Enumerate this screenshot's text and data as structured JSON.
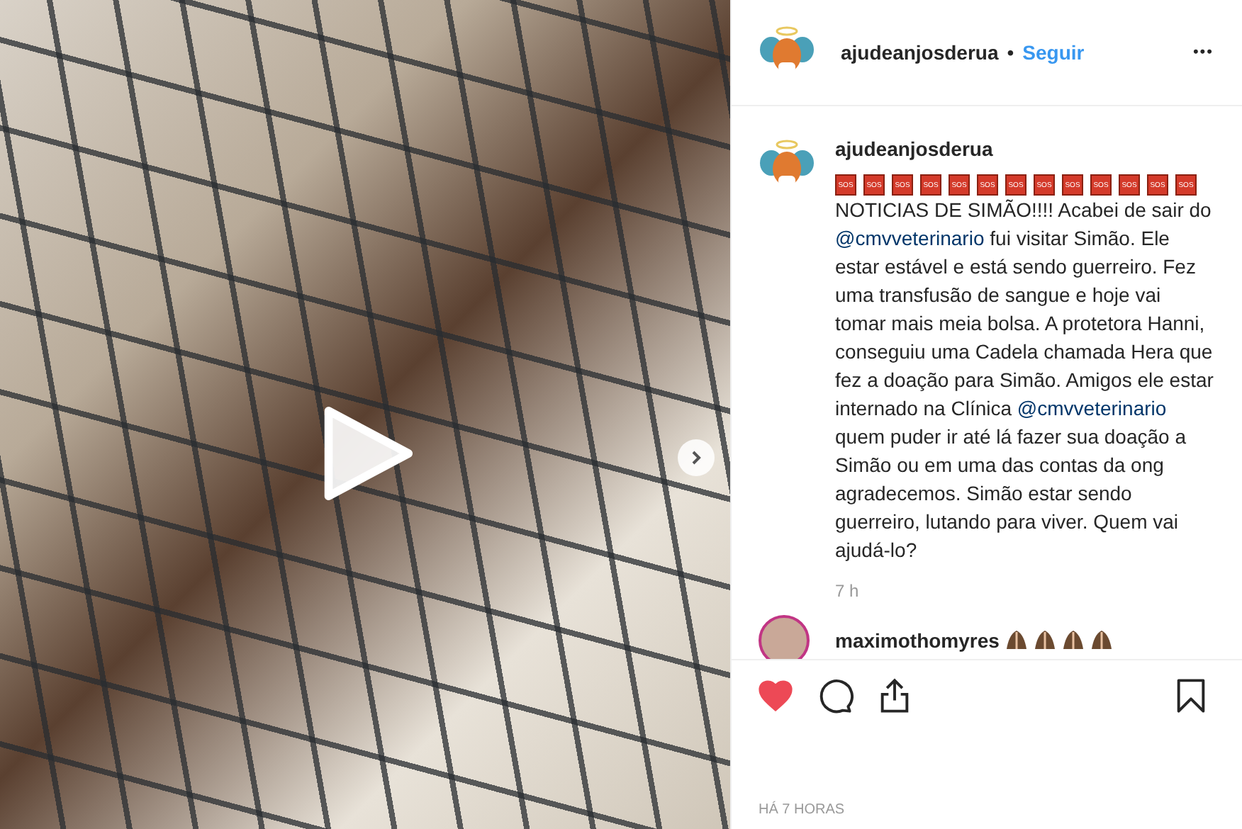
{
  "post": {
    "author": "ajudeanjosderua",
    "separator": "•",
    "follow": "Seguir",
    "more": "•••"
  },
  "caption": {
    "author": "ajudeanjosderua",
    "badges": [
      "SOS",
      "SOS",
      "SOS",
      "SOS",
      "SOS",
      "SOS",
      "SOS",
      "SOS",
      "SOS",
      "SOS",
      "SOS",
      "SOS",
      "SOS"
    ],
    "segments": [
      {
        "kind": "text",
        "text": "NOTICIAS DE SIMÃO!!!! Acabei de sair do "
      },
      {
        "kind": "mention",
        "text": "@cmvveterinario"
      },
      {
        "kind": "text",
        "text": " fui visitar Simão. Ele estar estável e está sendo guerreiro. Fez uma transfusão de sangue e hoje vai tomar mais meia bolsa. A protetora Hanni, conseguiu uma Cadela chamada Hera que fez a doação para Simão. Amigos ele estar internado na Clínica "
      },
      {
        "kind": "mention",
        "text": "@cmvveterinario"
      },
      {
        "kind": "text",
        "text": " quem puder ir até lá fazer sua doação a Simão ou em uma das contas da ong agradecemos. Simão estar sendo guerreiro, lutando para viver. Quem vai ajudá-lo?"
      }
    ],
    "time": "7 h"
  },
  "comment": {
    "author": "maximothomyres"
  },
  "actions": {
    "liked": true,
    "saved": false
  },
  "timestamp": "HÁ 7 HORAS"
}
